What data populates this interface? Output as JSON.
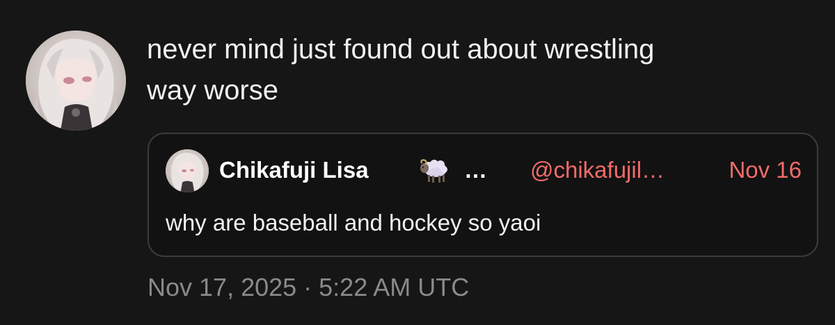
{
  "post": {
    "author": {
      "avatar": "anime-girl-avatar"
    },
    "text": "never mind just found out about wrestling\nway worse",
    "timestamp": "Nov 17, 2025 · 5:22 AM UTC"
  },
  "quote": {
    "author_name": "Chikafuji Lisa",
    "author_emoji": "sheep-emoji",
    "name_ellipsis": "…",
    "handle": "@chikafujil…",
    "date": "Nov 16",
    "text": "why are baseball and hockey so yaoi"
  },
  "colors": {
    "background": "#161616",
    "quote_border": "#3c3c3c",
    "accent": "#f26b6b",
    "text": "#f2f2f2",
    "muted": "#8a8a8a"
  }
}
